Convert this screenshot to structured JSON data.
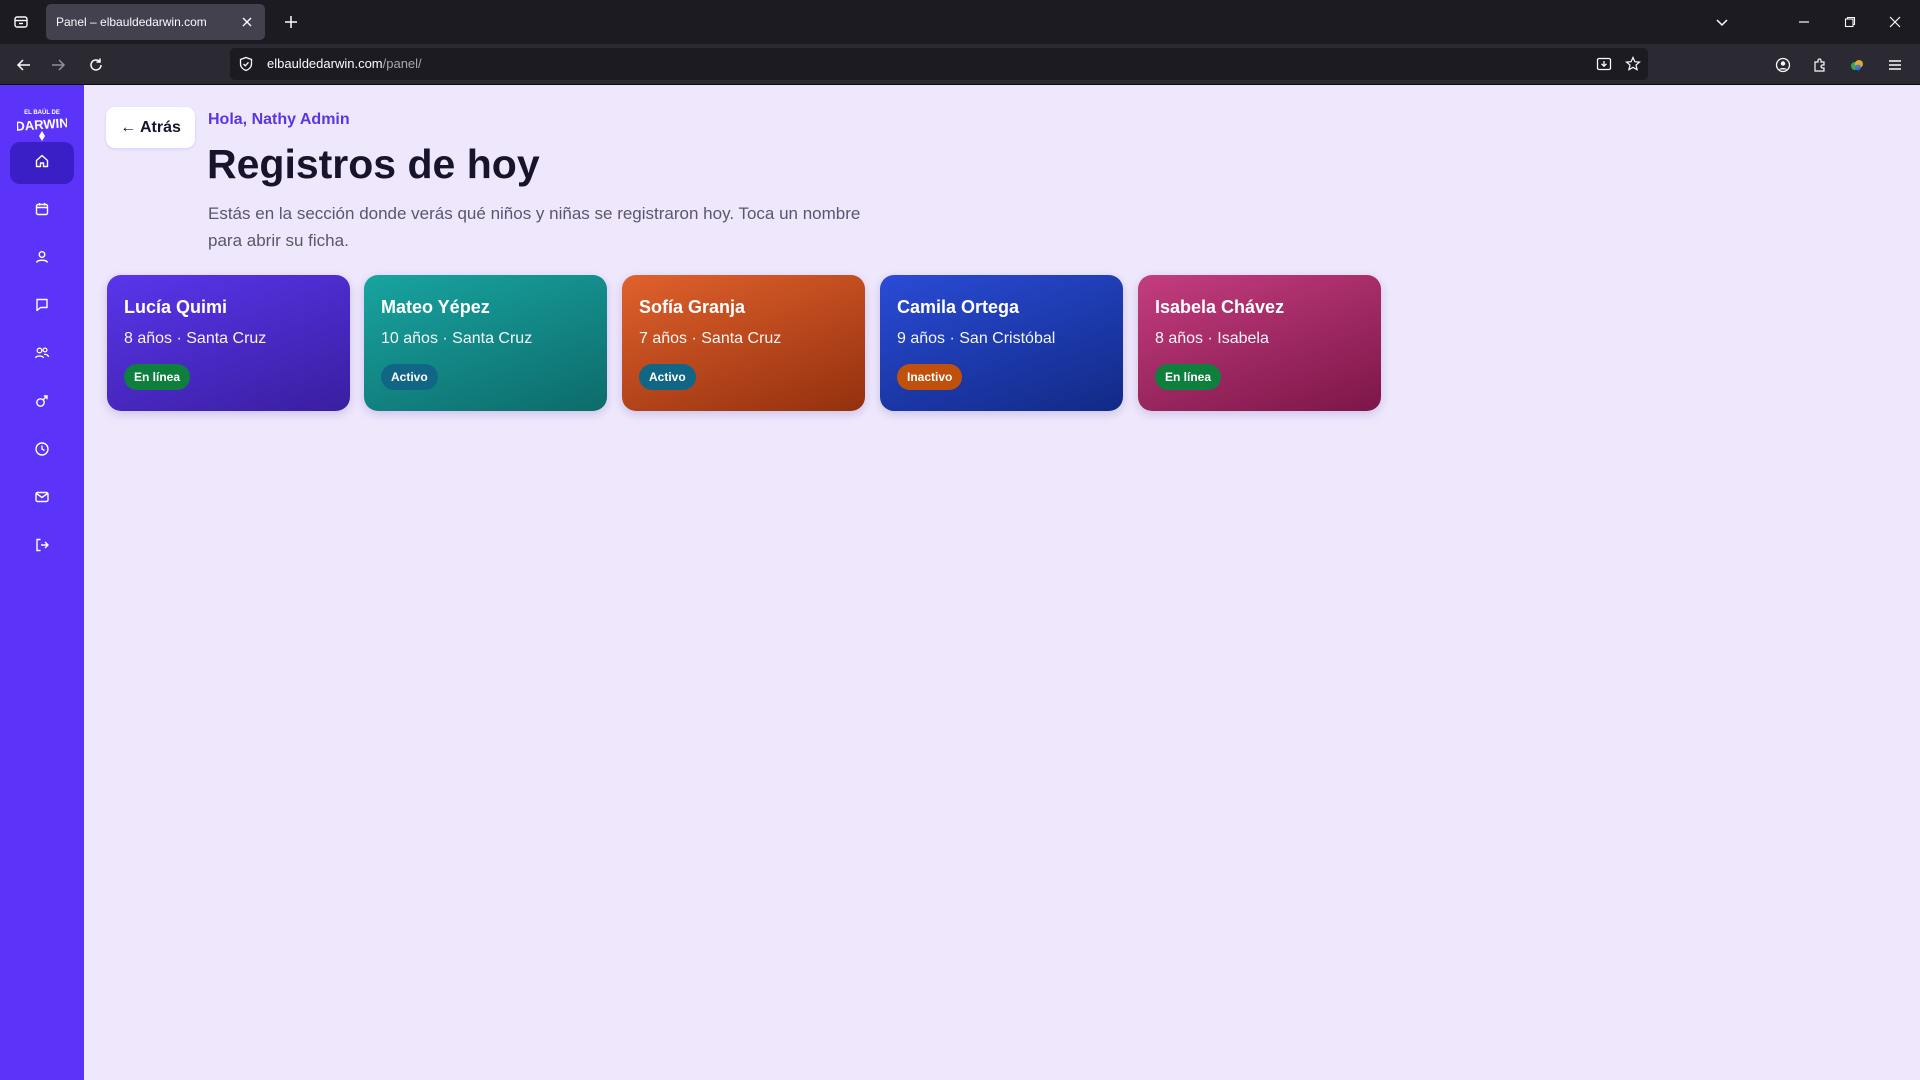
{
  "browser": {
    "tab_title": "Panel – elbauldedarwin.com",
    "url_domain": "elbauldedarwin.com",
    "url_path": "/panel/"
  },
  "sidebar": {
    "logo_alt": "El Baúl de Darwin",
    "items": [
      {
        "icon": "home-icon",
        "active": true
      },
      {
        "icon": "calendar-icon",
        "active": false
      },
      {
        "icon": "user-icon",
        "active": false
      },
      {
        "icon": "chat-icon",
        "active": false
      },
      {
        "icon": "group-icon",
        "active": false
      },
      {
        "icon": "gender-icon",
        "active": false
      },
      {
        "icon": "clock-icon",
        "active": false
      },
      {
        "icon": "mail-icon",
        "active": false
      },
      {
        "icon": "logout-icon",
        "active": false
      }
    ]
  },
  "main": {
    "back_label": "← Atrás",
    "greeting": "Hola, Nathy Admin",
    "title": "Registros de hoy",
    "intro": "Estás en la sección donde verás qué niños y niñas se registraron hoy. Toca un nombre para abrir su ficha."
  },
  "cards": [
    {
      "name": "Lucía Quimi",
      "meta": "8 años · Santa Cruz",
      "status": "En línea",
      "status_color": "#0f7f3e"
    },
    {
      "name": "Mateo Yépez",
      "meta": "10 años · Santa Cruz",
      "status": "Activo",
      "status_color": "#126685"
    },
    {
      "name": "Sofía Granja",
      "meta": "7 años · Santa Cruz",
      "status": "Activo",
      "status_color": "#126685"
    },
    {
      "name": "Camila Ortega",
      "meta": "9 años · San Cristóbal",
      "status": "Inactivo",
      "status_color": "#c2500d"
    },
    {
      "name": "Isabela Chávez",
      "meta": "8 años · Isabela",
      "status": "En línea",
      "status_color": "#0f7f3e"
    }
  ],
  "colors": {
    "sidebar": "#5c33f9",
    "background": "#efe8fd",
    "accent": "#5b35e4"
  }
}
